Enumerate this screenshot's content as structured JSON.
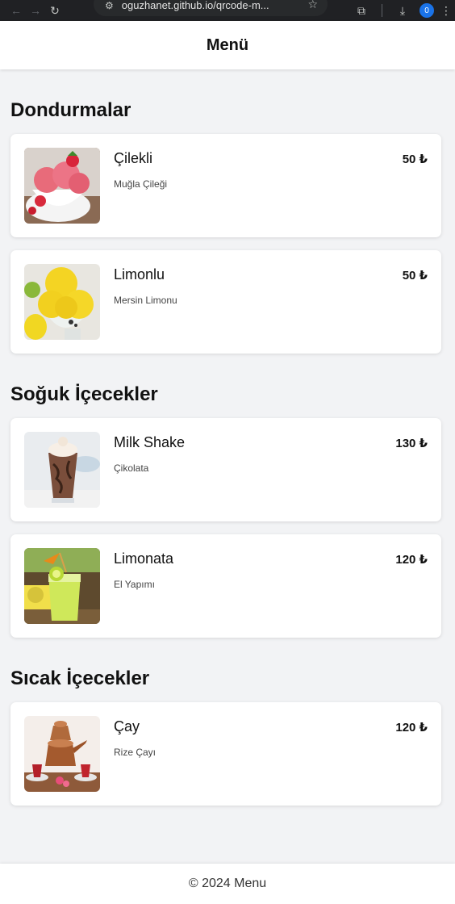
{
  "browser": {
    "url": "oguzhanet.github.io/qrcode-m...",
    "back_icon": "←",
    "forward_icon": "→",
    "reload_icon": "↻",
    "tune_icon": "⚙",
    "star_icon": "☆",
    "extensions_icon": "⧉",
    "download_icon": "⤓",
    "profile_initial": "0",
    "menu_icon": "⋮"
  },
  "header": {
    "title": "Menü"
  },
  "sections": [
    {
      "title": "Dondurmalar",
      "items": [
        {
          "name": "Çilekli",
          "desc": "Muğla Çileği",
          "price": "50 ₺",
          "image": "strawberry-ice-cream"
        },
        {
          "name": "Limonlu",
          "desc": "Mersin Limonu",
          "price": "50 ₺",
          "image": "lemon-ice-cream"
        }
      ]
    },
    {
      "title": "Soğuk İçecekler",
      "items": [
        {
          "name": "Milk Shake",
          "desc": "Çikolata",
          "price": "130 ₺",
          "image": "chocolate-milkshake"
        },
        {
          "name": "Limonata",
          "desc": "El Yapımı",
          "price": "120 ₺",
          "image": "lemonade"
        }
      ]
    },
    {
      "title": "Sıcak İçecekler",
      "items": [
        {
          "name": "Çay",
          "desc": "Rize Çayı",
          "price": "120 ₺",
          "image": "turkish-tea"
        }
      ]
    }
  ],
  "footer": {
    "text": "© 2024 Menu"
  }
}
